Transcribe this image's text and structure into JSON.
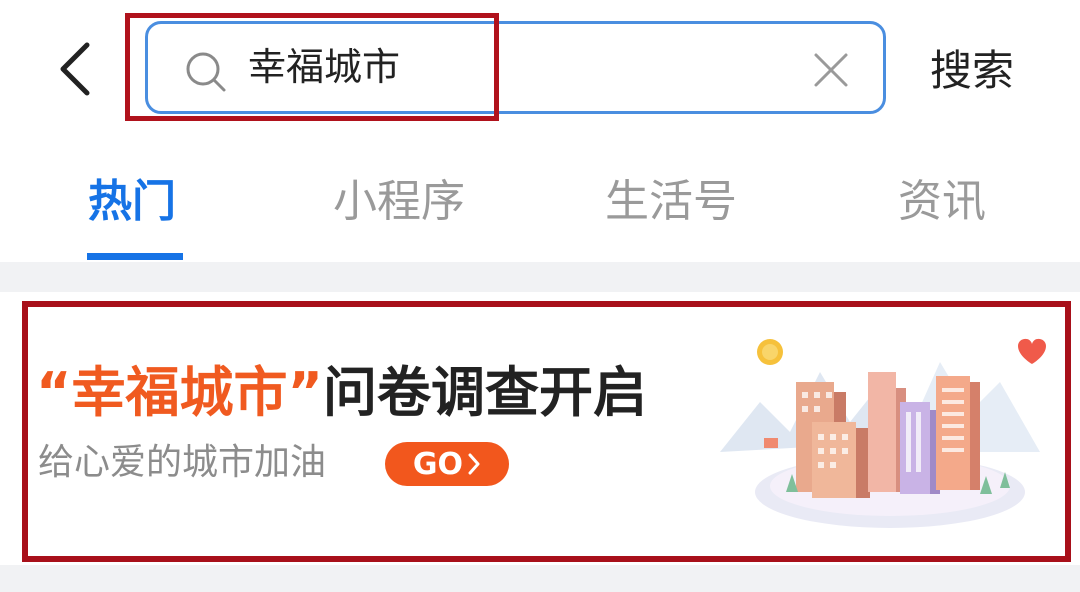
{
  "header": {
    "back_icon": "chevron-left-icon",
    "search": {
      "value": "幸福城市",
      "icon": "search-icon",
      "clear_icon": "close-icon"
    },
    "search_button_label": "搜索",
    "accent_color": "#4a8ee0",
    "highlight_color": "#b0121c"
  },
  "tabs": [
    {
      "label": "热门",
      "active": true
    },
    {
      "label": "小程序",
      "active": false
    },
    {
      "label": "生活号",
      "active": false
    },
    {
      "label": "资讯",
      "active": false
    }
  ],
  "tab_active_color": "#1673e6",
  "banner": {
    "title_highlight": "“幸福城市”",
    "title_rest": "问卷调查开启",
    "subtitle": "给心爱的城市加油",
    "go_label": "GO",
    "go_icon": "chevron-right-icon",
    "highlight_color": "#f05a20",
    "button_color": "#f2571d",
    "illustration": "city-buildings-illustration"
  }
}
